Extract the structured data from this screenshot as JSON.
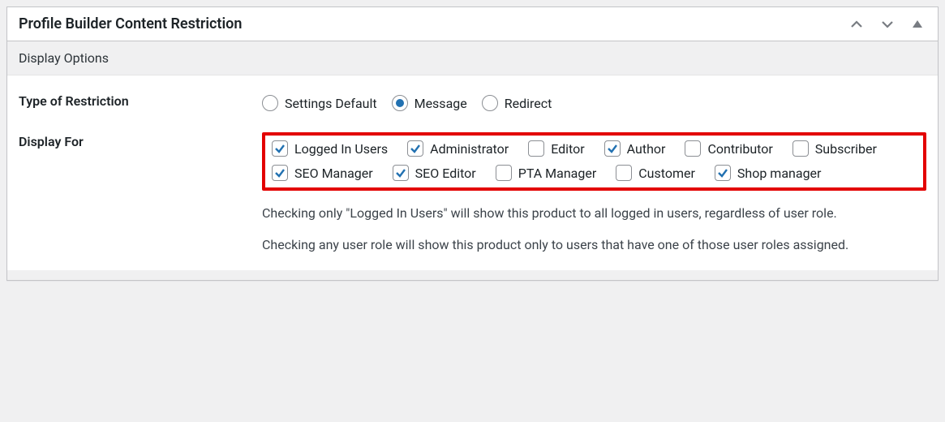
{
  "metabox": {
    "title": "Profile Builder Content Restriction"
  },
  "section": {
    "display_options": "Display Options"
  },
  "restriction": {
    "label": "Type of Restriction",
    "options": {
      "settings_default": "Settings Default",
      "message": "Message",
      "redirect": "Redirect"
    },
    "selected": "message"
  },
  "display_for": {
    "label": "Display For",
    "roles": {
      "logged_in": {
        "label": "Logged In Users",
        "checked": true
      },
      "administrator": {
        "label": "Administrator",
        "checked": true
      },
      "editor": {
        "label": "Editor",
        "checked": false
      },
      "author": {
        "label": "Author",
        "checked": true
      },
      "contributor": {
        "label": "Contributor",
        "checked": false
      },
      "subscriber": {
        "label": "Subscriber",
        "checked": false
      },
      "seo_manager": {
        "label": "SEO Manager",
        "checked": true
      },
      "seo_editor": {
        "label": "SEO Editor",
        "checked": true
      },
      "pta_manager": {
        "label": "PTA Manager",
        "checked": false
      },
      "customer": {
        "label": "Customer",
        "checked": false
      },
      "shop_manager": {
        "label": "Shop manager",
        "checked": true
      }
    },
    "hint1": "Checking only \"Logged In Users\" will show this product to all logged in users, regardless of user role.",
    "hint2": "Checking any user role will show this product only to users that have one of those user roles assigned."
  },
  "colors": {
    "accent": "#2271b1",
    "highlight": "#e30000"
  }
}
